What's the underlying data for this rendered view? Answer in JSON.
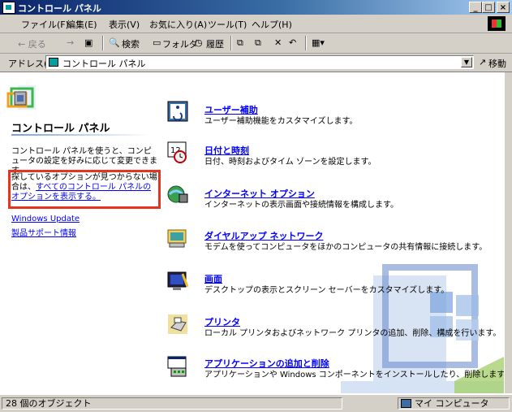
{
  "window": {
    "title": "コントロール パネル",
    "buttons": {
      "minimize": "_",
      "maximize": "□",
      "close": "×"
    }
  },
  "menu": [
    "ファイル(F)",
    "編集(E)",
    "表示(V)",
    "お気に入り(A)",
    "ツール(T)",
    "ヘルプ(H)"
  ],
  "toolbar": {
    "back": "← 戻る",
    "forward": "→",
    "search": "検索",
    "folders": "フォルダ",
    "history": "履歴"
  },
  "address": {
    "label": "アドレス(D)",
    "value": "コントロール パネル",
    "go": "移動"
  },
  "left_panel": {
    "title": "コントロール パネル",
    "description": "コントロール パネルを使うと、コンピュータの設定を好みに応じて変更できます。",
    "hint_text": "探しているオプションが見つからない場合は、",
    "hint_link": "すべてのコントロール パネルのオプションを表示する。",
    "links": [
      "Windows Update",
      "製品サポート情報"
    ]
  },
  "items": [
    {
      "title": "ユーザー補助",
      "desc": "ユーザー補助機能をカスタマイズします。",
      "icon": "accessibility-icon"
    },
    {
      "title": "日付と時刻",
      "desc": "日付、時刻およびタイム ゾーンを設定します。",
      "icon": "date-time-icon"
    },
    {
      "title": "インターネット オプション",
      "desc": "インターネットの表示画面や接続情報を構成します。",
      "icon": "internet-options-icon"
    },
    {
      "title": "ダイヤルアップ ネットワーク",
      "desc": "モデムを使ってコンピュータをほかのコンピュータの共有情報に接続します。",
      "icon": "dialup-network-icon"
    },
    {
      "title": "画面",
      "desc": "デスクトップの表示とスクリーン セーバーをカスタマイズします。",
      "icon": "display-icon"
    },
    {
      "title": "プリンタ",
      "desc": "ローカル プリンタおよびネットワーク プリンタの追加、削除、構成を行います。",
      "icon": "printer-icon"
    },
    {
      "title": "アプリケーションの追加と削除",
      "desc": "アプリケーションや Windows コンポーネントをインストールしたり、削除します。",
      "icon": "add-remove-programs-icon"
    }
  ],
  "status": {
    "left": "28 個のオブジェクト",
    "right": "マイ コンピュータ"
  },
  "colors": {
    "highlight_border": "#e8341c",
    "link": "#0000ff",
    "titlebar": "#0a246a"
  }
}
